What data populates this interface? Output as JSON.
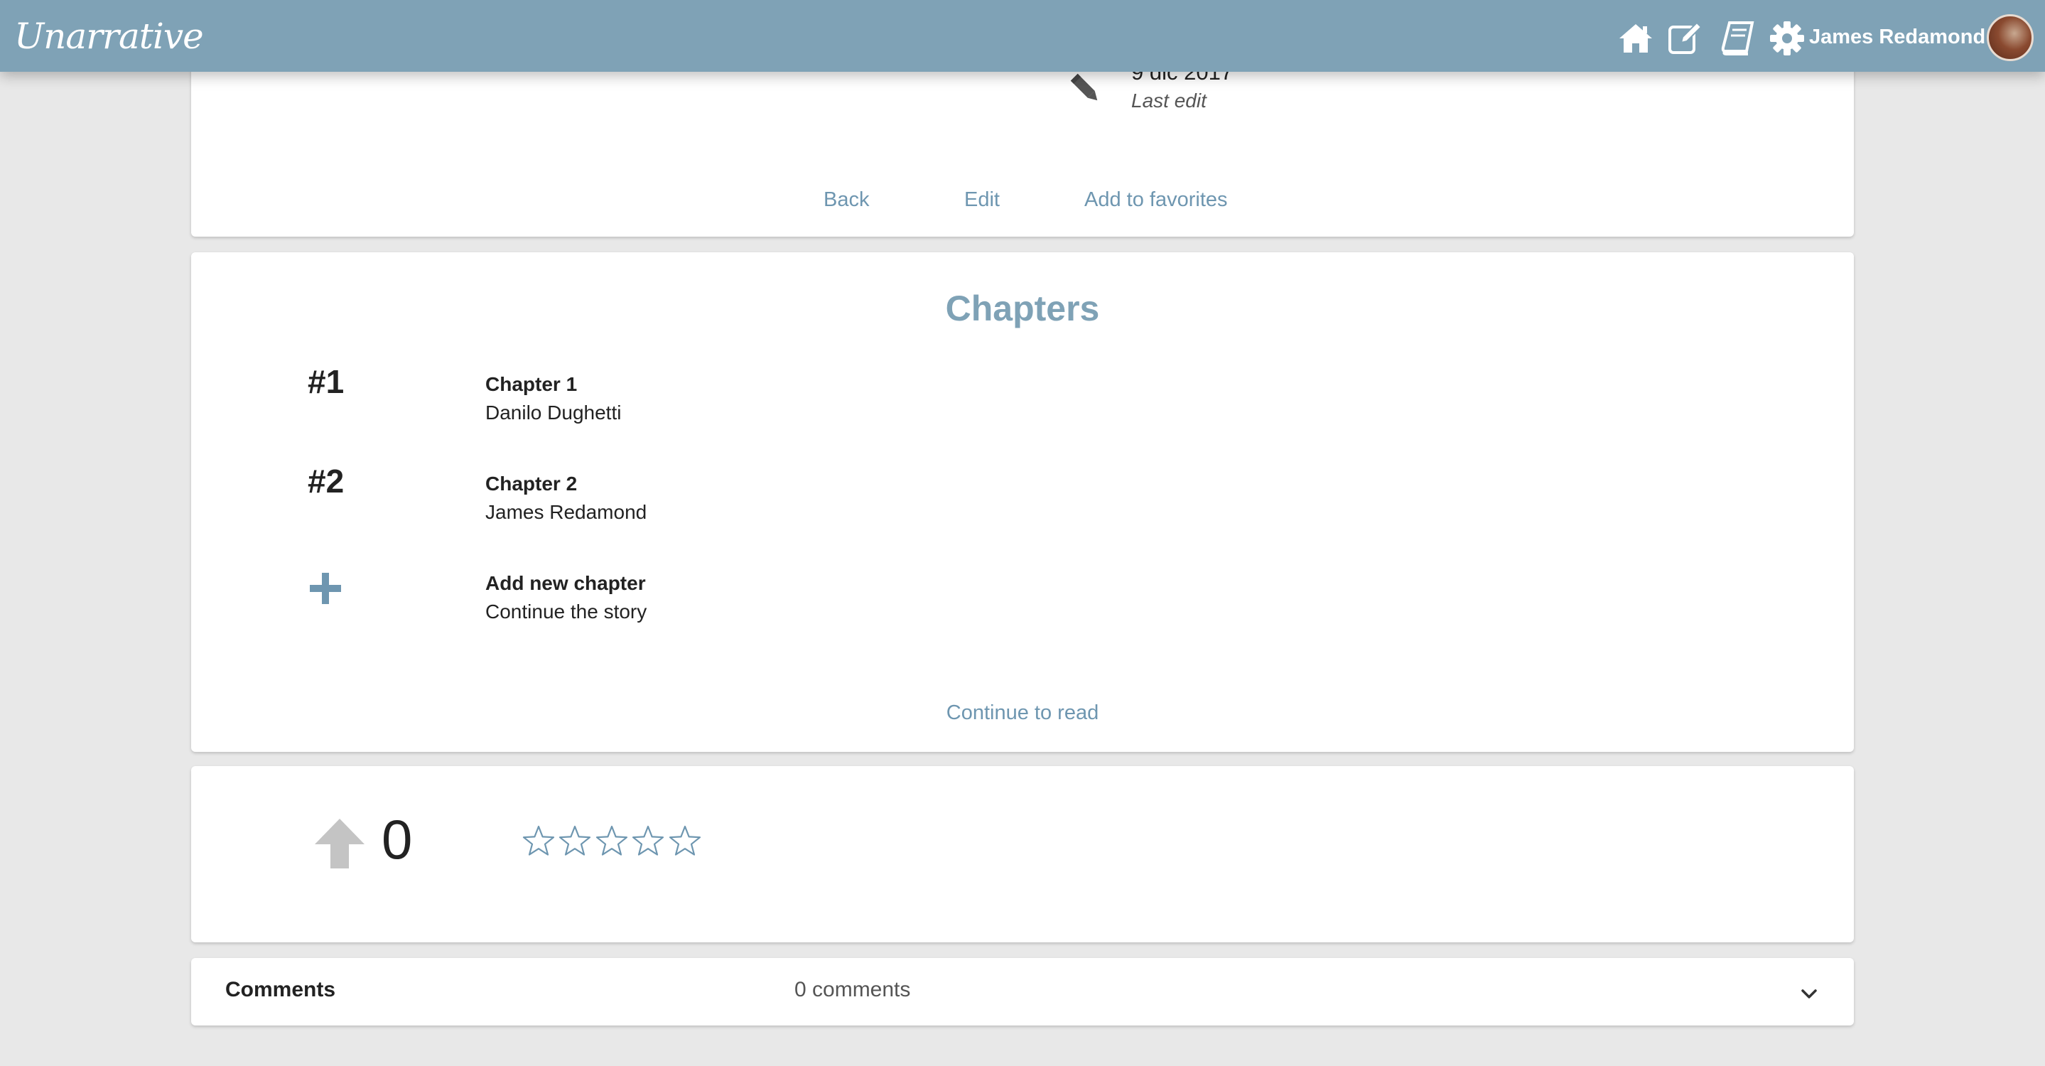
{
  "header": {
    "logo_text": "Unarrative",
    "user_name": "James Redamond",
    "accent_color": "#7fa2b6",
    "icons": [
      "home-icon",
      "write-icon",
      "book-icon",
      "gear-icon"
    ]
  },
  "story_info": {
    "last_edit_date": "9 dic 2017",
    "last_edit_label": "Last edit",
    "actions": {
      "back": "Back",
      "edit": "Edit",
      "favorites": "Add to favorites"
    }
  },
  "chapters": {
    "title": "Chapters",
    "items": [
      {
        "number": "#1",
        "title": "Chapter 1",
        "author": "Danilo Dughetti"
      },
      {
        "number": "#2",
        "title": "Chapter 2",
        "author": "James Redamond"
      }
    ],
    "add_new": {
      "title": "Add new chapter",
      "subtitle": "Continue the story"
    },
    "continue_label": "Continue to read"
  },
  "rating": {
    "upvotes": "0",
    "stars_filled": 0,
    "stars_total": 5
  },
  "comments": {
    "label": "Comments",
    "count_text": "0 comments"
  }
}
